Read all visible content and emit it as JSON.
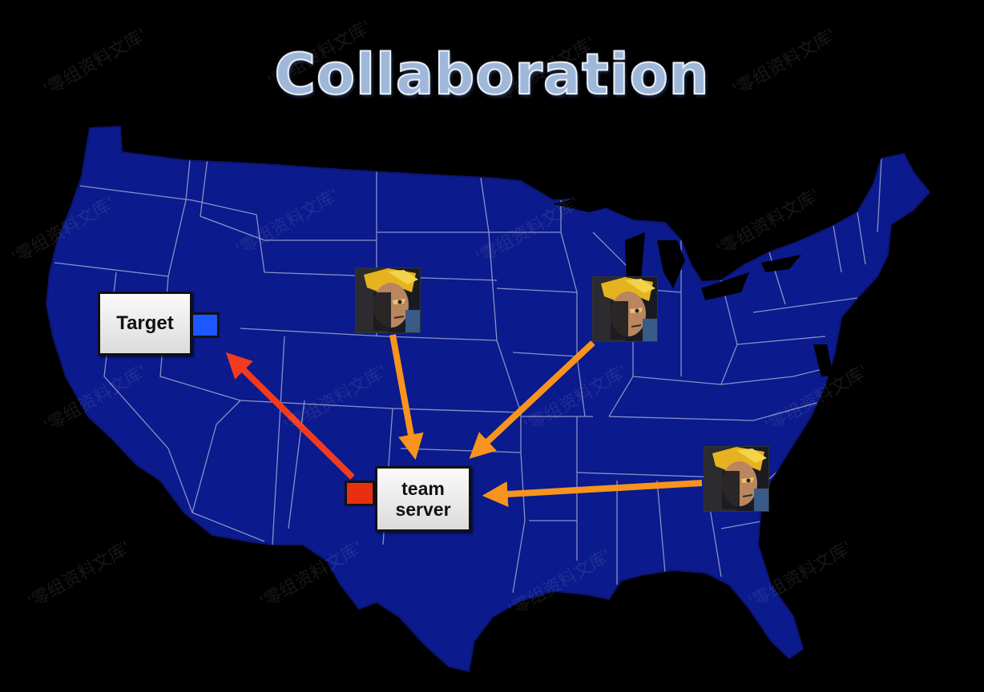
{
  "slide": {
    "title": "Collaboration",
    "background": "#000000",
    "map_fill": "#0b1a8c",
    "state_border": "#8a90c8"
  },
  "nodes": {
    "target": {
      "label": "Target",
      "port_color": "#1e56ff"
    },
    "team_server": {
      "label": "team\nserver",
      "port_color": "#e83010"
    }
  },
  "clients": [
    {
      "icon": "avatar-icon"
    },
    {
      "icon": "avatar-icon"
    },
    {
      "icon": "avatar-icon"
    }
  ],
  "connections": {
    "client_to_server_color": "#f7941d",
    "server_to_target_color": "#f23a1e"
  },
  "watermark": "'零组资料文库'"
}
